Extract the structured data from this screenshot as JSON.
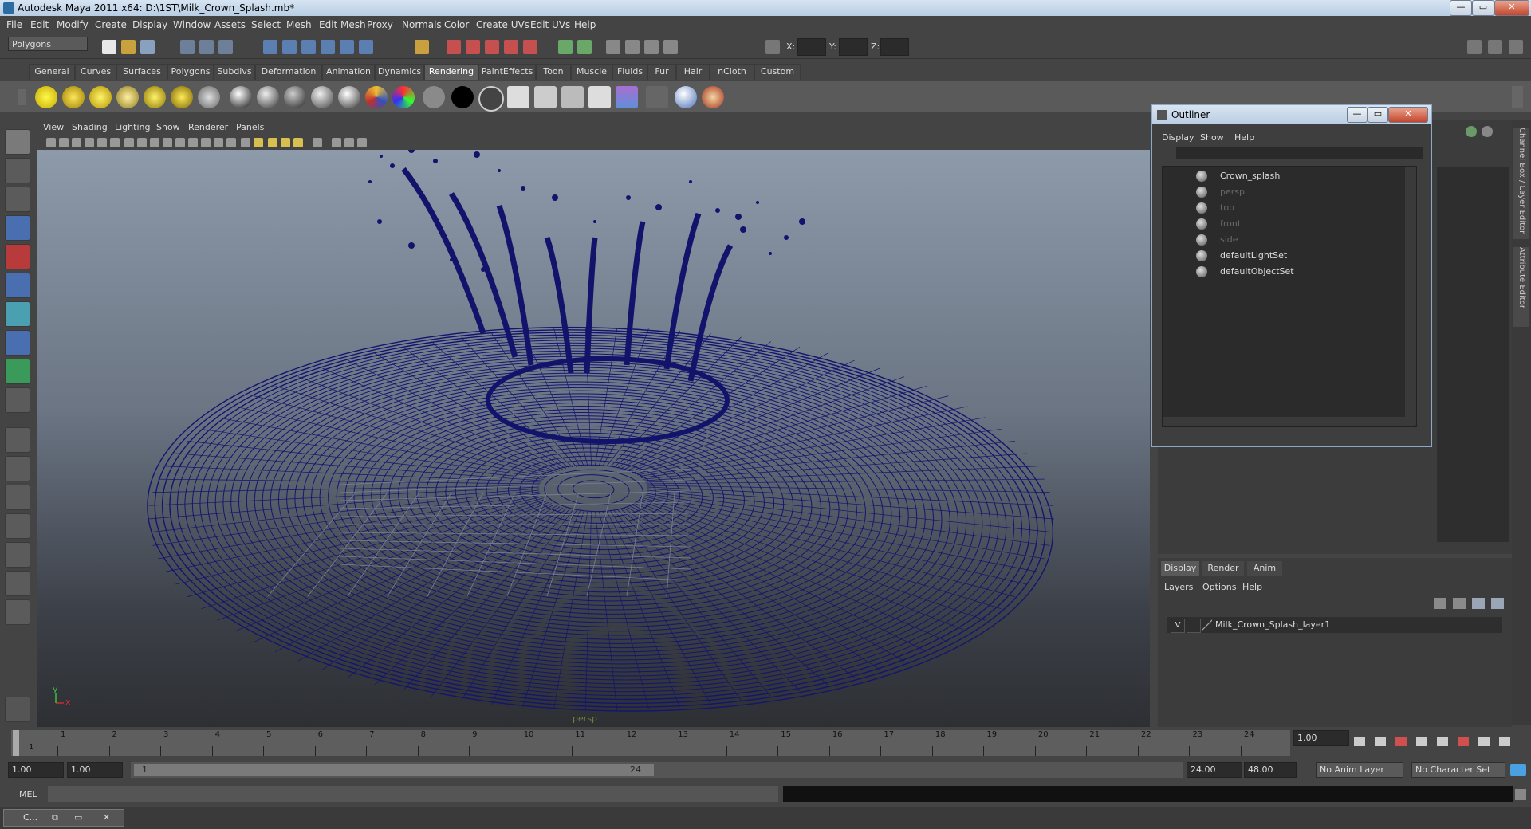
{
  "window": {
    "title": "Autodesk Maya 2011 x64: D:\\1ST\\Milk_Crown_Splash.mb*",
    "min": "—",
    "max": "▭",
    "close": "✕"
  },
  "menu": [
    "File",
    "Edit",
    "Modify",
    "Create",
    "Display",
    "Window",
    "Assets",
    "Select",
    "Mesh",
    "Edit Mesh",
    "Proxy",
    "Normals",
    "Color",
    "Create UVs",
    "Edit UVs",
    "Help"
  ],
  "status": {
    "menuset": "Polygons",
    "x_label": "X:",
    "y_label": "Y:",
    "z_label": "Z:"
  },
  "shelf_tabs": [
    "General",
    "Curves",
    "Surfaces",
    "Polygons",
    "Subdivs",
    "Deformation",
    "Animation",
    "Dynamics",
    "Rendering",
    "PaintEffects",
    "Toon",
    "Muscle",
    "Fluids",
    "Fur",
    "Hair",
    "nCloth",
    "Custom"
  ],
  "shelf_active": "Rendering",
  "viewport": {
    "menu": [
      "View",
      "Shading",
      "Lighting",
      "Show",
      "Renderer",
      "Panels"
    ],
    "camera_label": "persp",
    "axis_x": "x",
    "axis_y": "y"
  },
  "outliner": {
    "title": "Outliner",
    "menu": [
      "Display",
      "Show",
      "Help"
    ],
    "items": [
      {
        "label": "Crown_splash",
        "dim": false
      },
      {
        "label": "persp",
        "dim": true
      },
      {
        "label": "top",
        "dim": true
      },
      {
        "label": "front",
        "dim": true
      },
      {
        "label": "side",
        "dim": true
      },
      {
        "label": "defaultLightSet",
        "dim": false
      },
      {
        "label": "defaultObjectSet",
        "dim": false
      }
    ]
  },
  "side_tabs": [
    "Channel Box / Layer Editor",
    "Attribute Editor"
  ],
  "layers": {
    "tabs": [
      "Display",
      "Render",
      "Anim"
    ],
    "menu": [
      "Layers",
      "Options",
      "Help"
    ],
    "visible": "V",
    "layer_name": "Milk_Crown_Splash_layer1"
  },
  "timeline": {
    "ticks": [
      "1",
      "2",
      "3",
      "4",
      "5",
      "6",
      "7",
      "8",
      "9",
      "10",
      "11",
      "12",
      "13",
      "14",
      "15",
      "16",
      "17",
      "18",
      "19",
      "20",
      "21",
      "22",
      "23",
      "24"
    ],
    "current_frame": "1",
    "current_field": "1.00"
  },
  "range": {
    "start": "1.00",
    "playback_start": "1.00",
    "slider_start": "1",
    "slider_end": "24",
    "playback_end": "24.00",
    "end": "48.00",
    "anim_layer": "No Anim Layer",
    "char_set": "No Character Set"
  },
  "cmd": {
    "label": "MEL"
  },
  "taskbar": {
    "item": "C..."
  }
}
